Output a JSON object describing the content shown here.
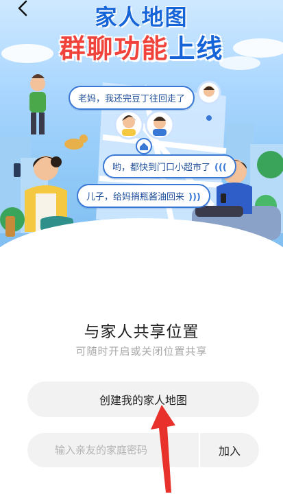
{
  "banner": {
    "title_top": "家人地图",
    "title_main_red": "群聊功能",
    "title_main_blue": "上线",
    "bubbles": [
      "老妈，我还完豆丁往回走了",
      "哟，都快到门口小超市了",
      "儿子，给妈捎瓶酱油回来"
    ]
  },
  "main": {
    "heading": "与家人共享位置",
    "subheading": "可随时开启或关闭位置共享",
    "create_button_label": "创建我的家人地图",
    "code_input_placeholder": "输入亲友的家庭密码",
    "join_button_label": "加入"
  },
  "icons": {
    "back": "chevron-left-icon",
    "home_pin": "home-pin-icon",
    "annotation_arrow": "red-arrow-icon"
  },
  "colors": {
    "title_blue": "#1565d8",
    "title_red": "#f0433b",
    "button_bg": "#f2f2f2",
    "arrow_red": "#e8312a"
  }
}
